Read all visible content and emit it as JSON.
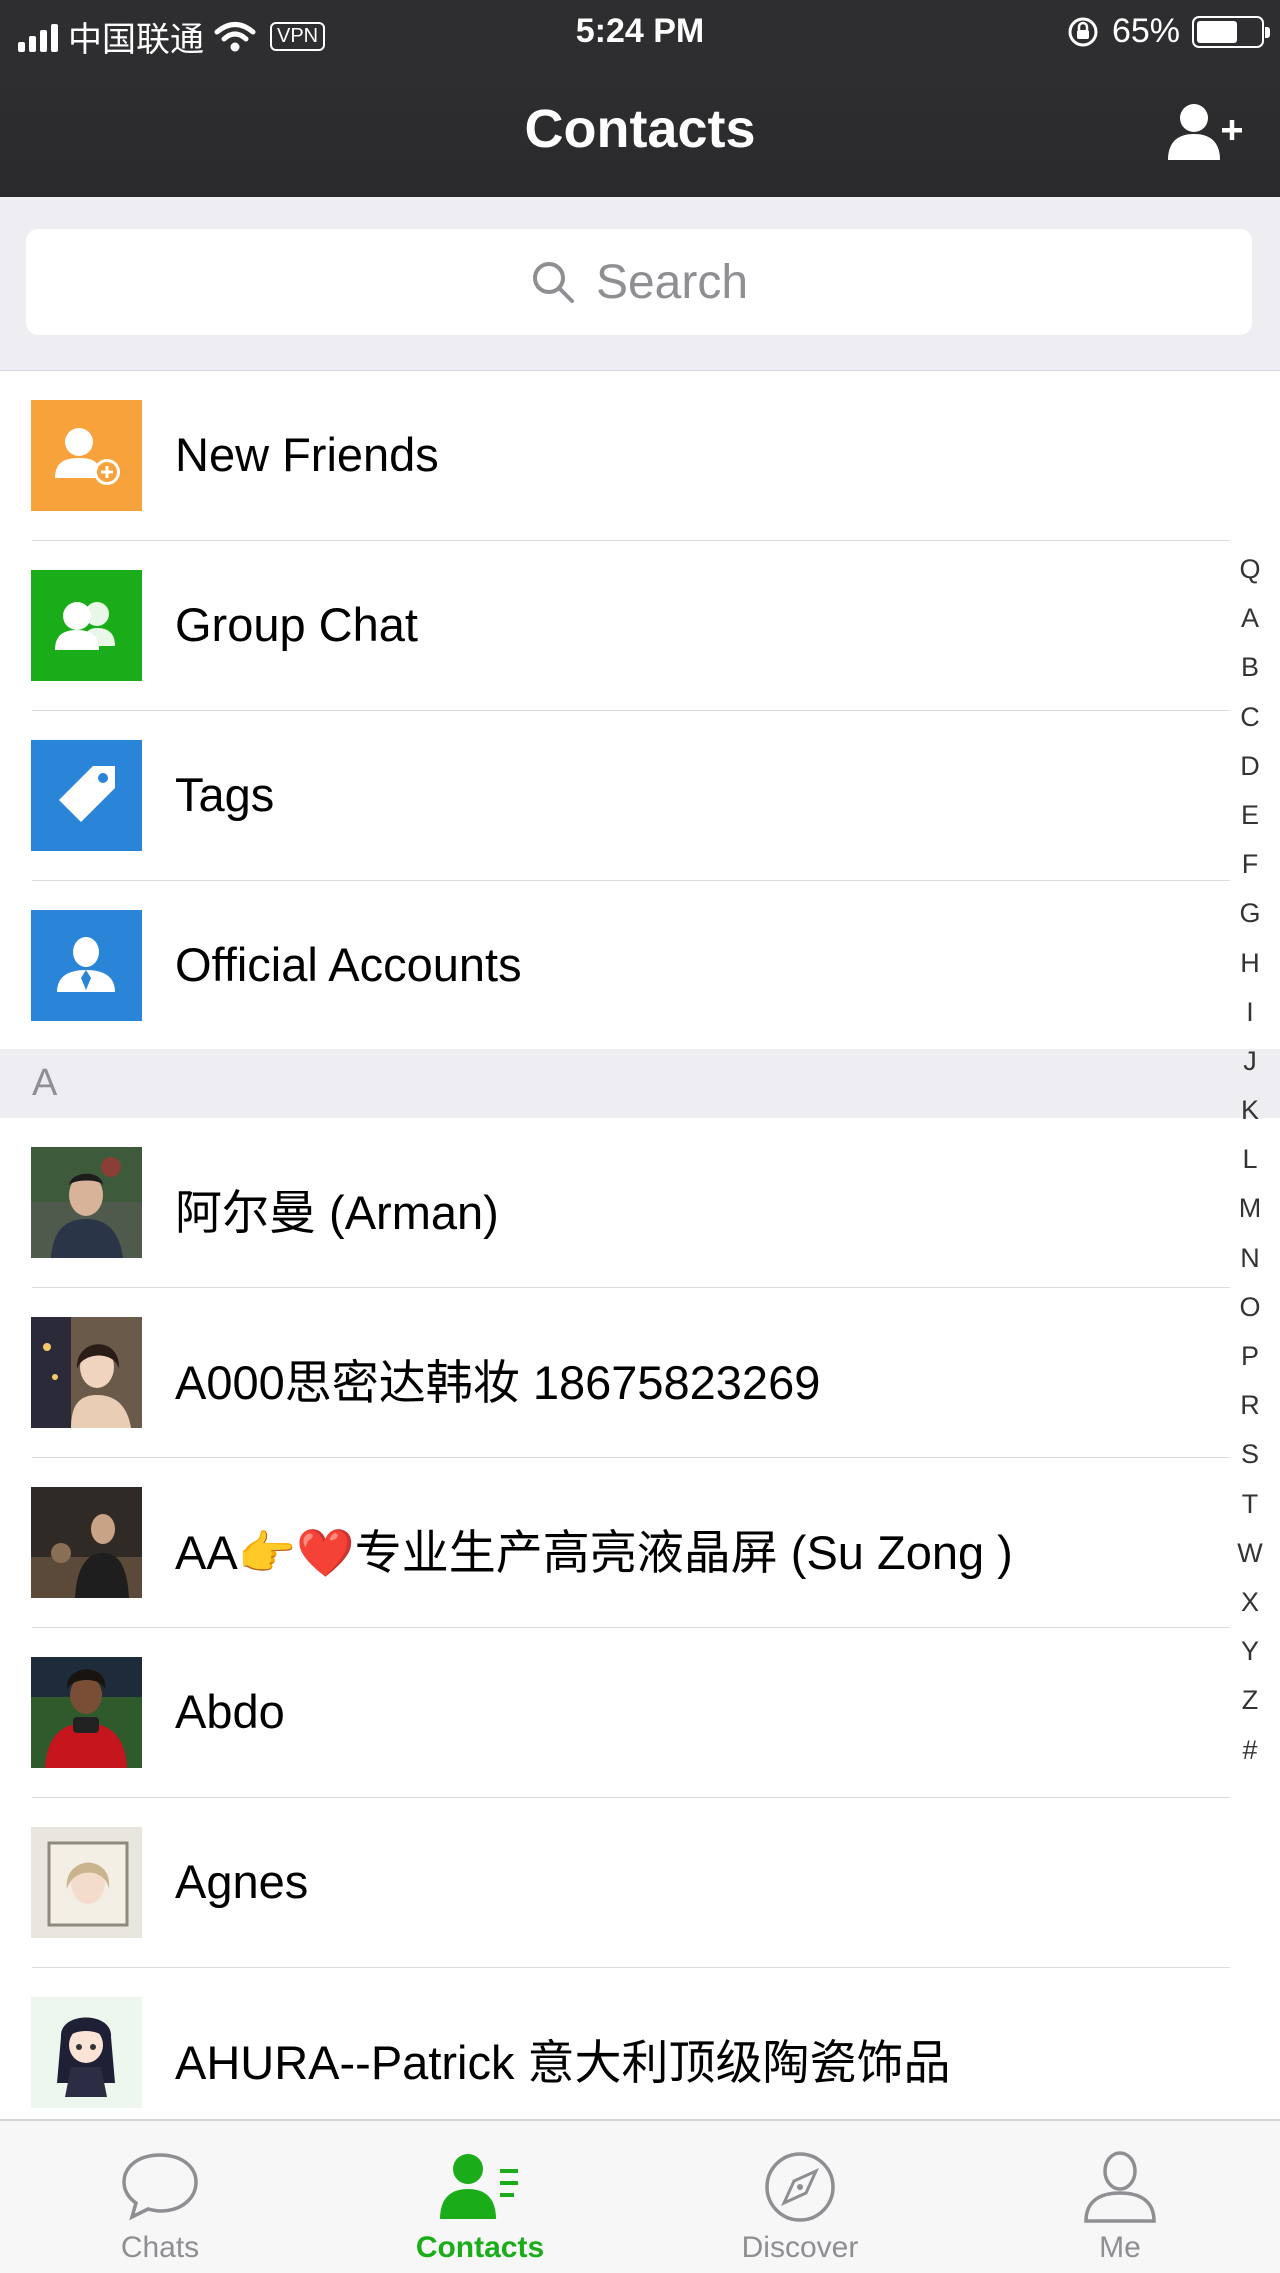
{
  "status_bar": {
    "carrier": "中国联通",
    "vpn": "VPN",
    "time": "5:24 PM",
    "battery": "65%",
    "battery_level": 0.65
  },
  "nav": {
    "title": "Contacts",
    "add_icon": "add-contact-icon"
  },
  "search": {
    "placeholder": "Search"
  },
  "functions": [
    {
      "label": "New Friends",
      "icon": "new-friends-icon",
      "color": "#f7a23b"
    },
    {
      "label": "Group Chat",
      "icon": "group-chat-icon",
      "color": "#1aad19"
    },
    {
      "label": "Tags",
      "icon": "tag-icon",
      "color": "#2a84d8"
    },
    {
      "label": "Official Accounts",
      "icon": "official-accounts-icon",
      "color": "#2a84d8"
    }
  ],
  "section": {
    "letter": "A"
  },
  "contacts": [
    {
      "name": "阿尔曼 (Arman)"
    },
    {
      "name": "A000思密达韩妆 18675823269"
    },
    {
      "name": "AA👉❤️专业生产高亮液晶屏 (Su Zong )"
    },
    {
      "name": "Abdo"
    },
    {
      "name": "Agnes"
    },
    {
      "name": "AHURA--Patrick 意大利顶级陶瓷饰品"
    }
  ],
  "index_letters": [
    "Q",
    "A",
    "B",
    "C",
    "D",
    "E",
    "F",
    "G",
    "H",
    "I",
    "J",
    "K",
    "L",
    "M",
    "N",
    "O",
    "P",
    "R",
    "S",
    "T",
    "W",
    "X",
    "Y",
    "Z",
    "#"
  ],
  "tabs": [
    {
      "label": "Chats",
      "icon": "chat-bubble-icon",
      "active": false
    },
    {
      "label": "Contacts",
      "icon": "contacts-icon",
      "active": true
    },
    {
      "label": "Discover",
      "icon": "compass-icon",
      "active": false
    },
    {
      "label": "Me",
      "icon": "person-icon",
      "active": false
    }
  ],
  "colors": {
    "nav_bg": "#2e2e30",
    "accent_green": "#1aad19",
    "section_bg": "#ededf2"
  }
}
